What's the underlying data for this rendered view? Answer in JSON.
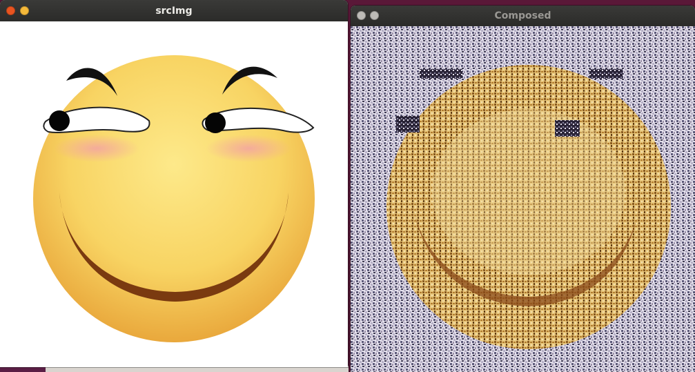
{
  "windows": {
    "source": {
      "title": "srcImg",
      "controls": [
        "close-icon",
        "minimize-icon"
      ]
    },
    "composed": {
      "title": "Composed",
      "controls": [
        "close-icon",
        "minimize-icon"
      ]
    }
  },
  "colors": {
    "face_light": "#fbe27a",
    "face_dark": "#e7a63c",
    "mouth": "#7a3a10",
    "blush": "#f3a8a8",
    "titlebar": "#2f2f2d",
    "close_active": "#e95420",
    "minimize_active": "#f5b93a",
    "mosaic_background": "#dcd7e6",
    "mosaic_face": "#c88a2e"
  }
}
